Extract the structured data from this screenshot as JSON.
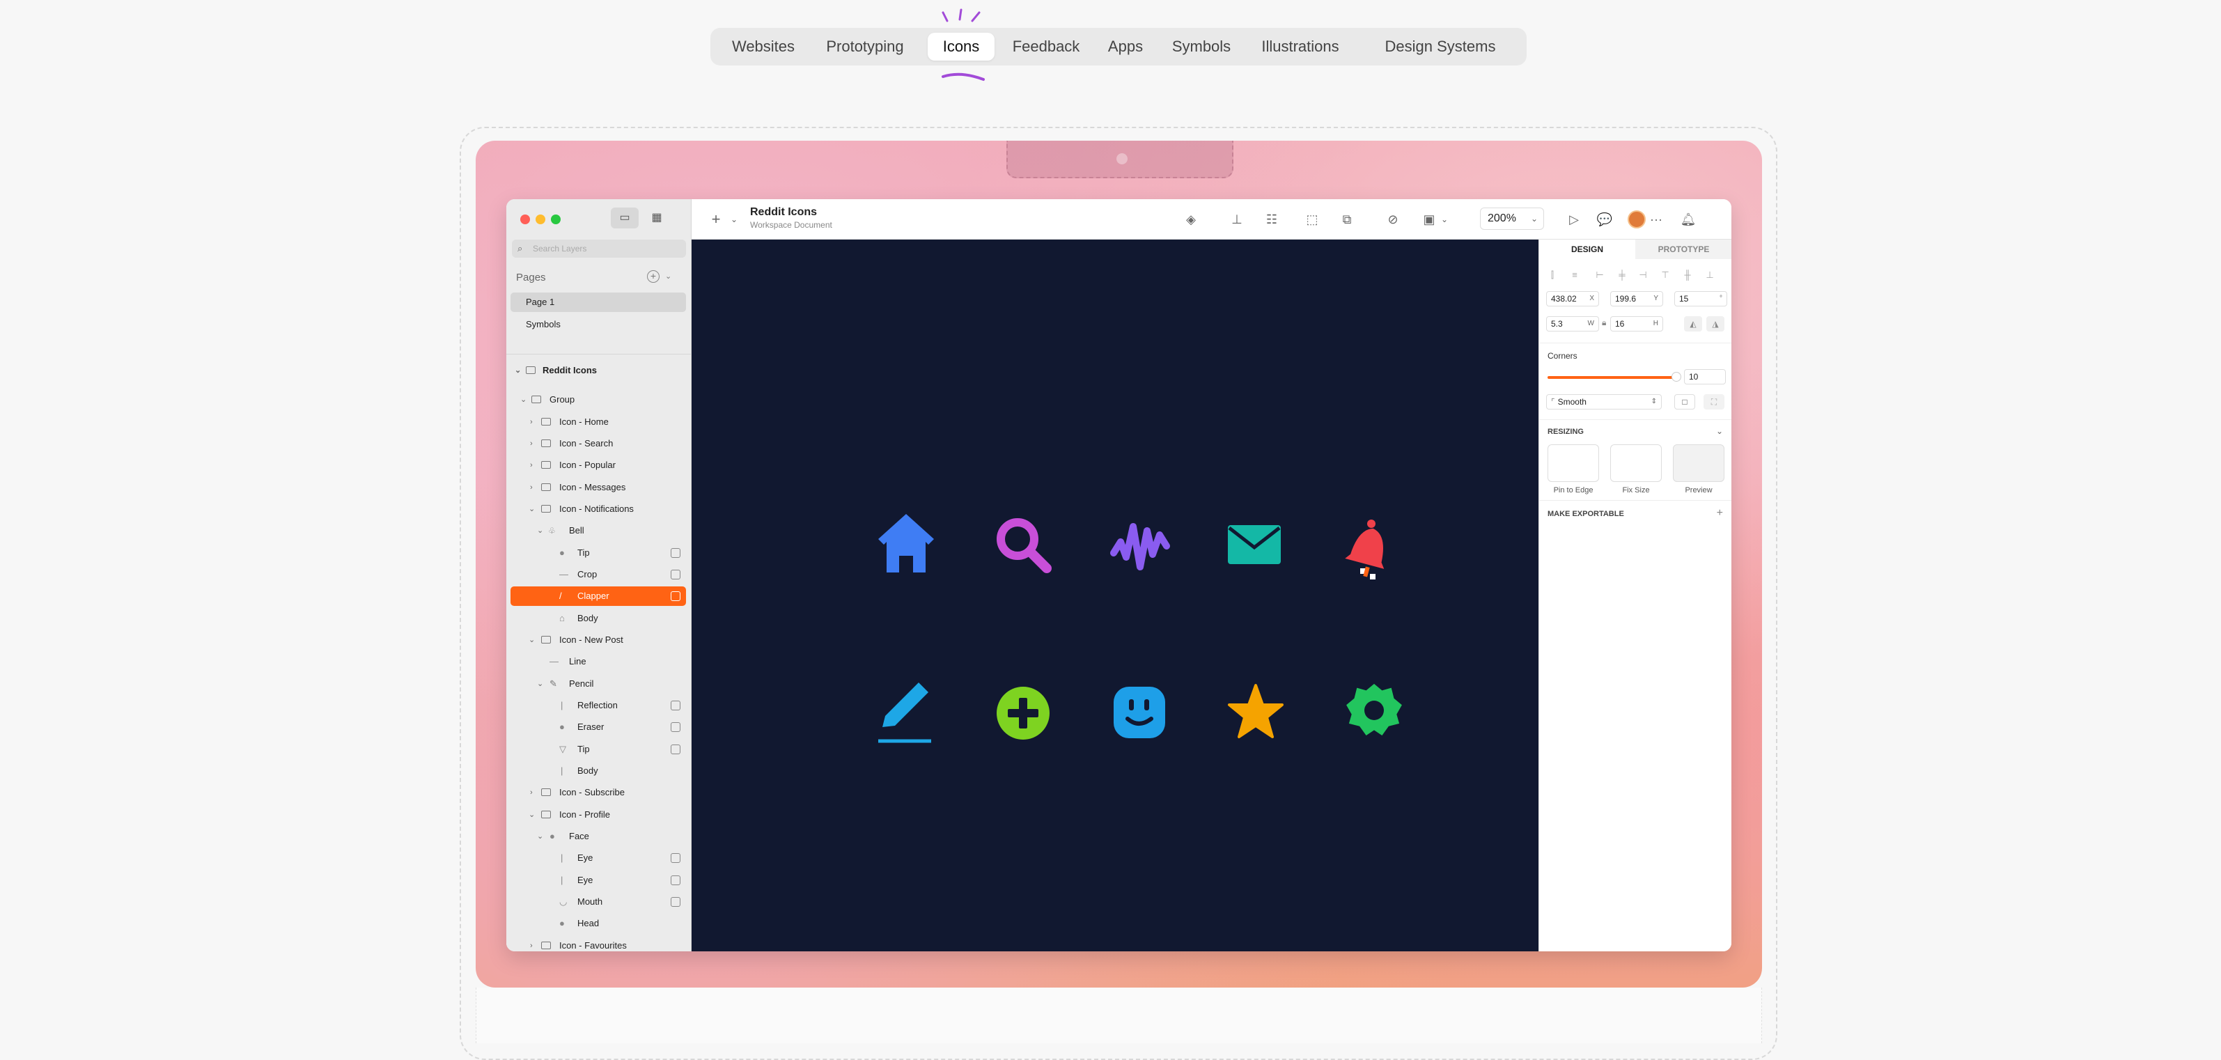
{
  "topnav": {
    "tabs": [
      "Websites",
      "Prototyping",
      "Icons",
      "Feedback",
      "Apps",
      "Symbols",
      "Illustrations",
      "Design Systems"
    ],
    "active": "Icons"
  },
  "sidebar": {
    "search_placeholder": "Search Layers",
    "pages_header": "Pages",
    "pages": [
      "Page 1",
      "Symbols"
    ],
    "document": "Reddit Icons",
    "layers": [
      "Group",
      "Icon - Home",
      "Icon - Search",
      "Icon - Popular",
      "Icon - Messages",
      "Icon - Notifications",
      "Bell",
      "Tip",
      "Crop",
      "Clapper",
      "Body",
      "Icon - New Post",
      "Line",
      "Pencil",
      "Reflection",
      "Eraser",
      "Tip",
      "Body",
      "Icon - Subscribe",
      "Icon - Profile",
      "Face",
      "Eye",
      "Eye",
      "Mouth",
      "Head",
      "Icon - Favourites"
    ]
  },
  "toolbar": {
    "title": "Reddit Icons",
    "subtitle": "Workspace Document",
    "zoom": "200%"
  },
  "inspector": {
    "tabs": [
      "DESIGN",
      "PROTOTYPE"
    ],
    "x": "438.02",
    "x_unit": "X",
    "y": "199.6",
    "y_unit": "Y",
    "rotation": "15",
    "w": "5.3",
    "w_unit": "W",
    "h": "16",
    "h_unit": "H",
    "corners_label": "Corners",
    "corners_value": "10",
    "smooth": "Smooth",
    "resizing": "RESIZING",
    "pin": "Pin to Edge",
    "fix": "Fix Size",
    "preview": "Preview",
    "exportable": "MAKE EXPORTABLE"
  },
  "icons": [
    "home-icon",
    "search-icon",
    "popular-icon",
    "messages-icon",
    "notifications-icon",
    "new-post-icon",
    "subscribe-icon",
    "profile-icon",
    "favourites-icon",
    "settings-icon"
  ],
  "colors": {
    "canvas": "#111830",
    "selection": "#ff6314",
    "home": "#3f7df4",
    "search": "#c84fd8",
    "popular": "#8a5cf0",
    "messages": "#14b8a6",
    "notifications": "#f0414a",
    "new_post": "#1ea7e6",
    "subscribe": "#7ed321",
    "profile": "#1e9fe8",
    "favourites": "#f5a300",
    "settings": "#22c55e"
  }
}
